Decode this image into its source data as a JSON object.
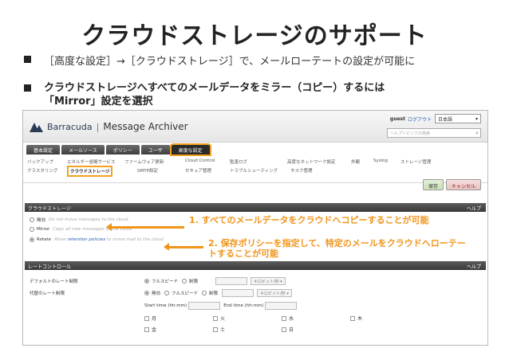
{
  "slide": {
    "title": "クラウドストレージのサポート",
    "bullet1": "［高度な設定］→［クラウドストレージ］で、メールローテートの設定が可能に",
    "bullet2_line1": "クラウドストレージへすべてのメールデータをミラー（コピー）するには",
    "bullet2_line2": "「Mirror」設定を選択"
  },
  "app": {
    "brand": "Barracuda",
    "separator": "|",
    "product": "Message Archiver",
    "user": "guest",
    "logout": "ログアウト",
    "language": "日本語",
    "search_placeholder": "ヘルプトピックの検索"
  },
  "tabs": [
    "基本設定",
    "メールソース",
    "ポリシー",
    "ユーザ",
    "高度な設定"
  ],
  "subnav": {
    "row1": [
      "バックアップ",
      "エネルギー省略サービス",
      "ファームウェア更新",
      "Cloud Control",
      "監査ログ",
      "高度なネットワーク設定",
      "外観",
      "Syslog",
      "ストレージ管理"
    ],
    "row2": [
      "クラスタリング",
      "クラウドストレージ",
      "SMTP設定",
      "セキュア管理",
      "トラブルシューティング",
      "タスク管理"
    ]
  },
  "buttons": {
    "save": "保存",
    "cancel": "キャンセル"
  },
  "cloud_panel": {
    "title": "クラウドストレージ",
    "help": "ヘルプ",
    "options": [
      {
        "label": "無効",
        "desc": "Do not move messages to the cloud",
        "selected": false
      },
      {
        "label": "Mirror",
        "desc": "Copy all new messages to the cloud",
        "selected": false
      },
      {
        "label": "Rotate",
        "desc_pre": "Allow ",
        "desc_link": "retention policies",
        "desc_post": " to move mail to the cloud",
        "selected": true
      }
    ]
  },
  "annotations": {
    "a1": "1. すべてのメールデータをクラウドへコピーすることが可能",
    "a2_line1": "2. 保存ポリシーを指定して、特定のメールをクラウドへローテー",
    "a2_line2": "トすることが可能"
  },
  "rate_panel": {
    "title": "レートコントロール",
    "help": "ヘルプ",
    "default_rate_label": "デフォルトのレート制限",
    "alt_rate_label": "代替のレート制限",
    "full_speed": "フルスピード",
    "limit": "制限",
    "disabled": "無効",
    "unit": "キロビット/秒",
    "start_time": "Start time (hh:mm)",
    "end_time": "End time (hh:mm)",
    "days": [
      "月",
      "火",
      "水",
      "木",
      "金",
      "土",
      "日"
    ]
  }
}
